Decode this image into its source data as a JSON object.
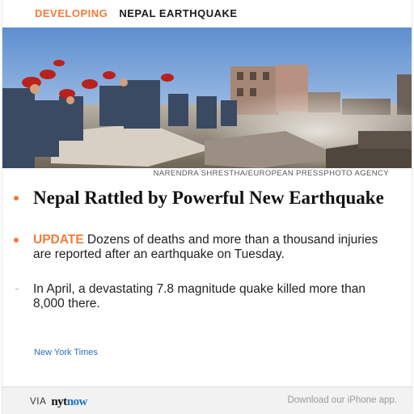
{
  "header": {
    "tag": "DEVELOPING",
    "topic": "NEPAL EARTHQUAKE"
  },
  "photo": {
    "credit": "NARENDRA SHRESTHA/EUROPEAN PRESSPHOTO AGENCY"
  },
  "article": {
    "headline": "Nepal Rattled by Powerful New Earthquake",
    "update_label": "UPDATE",
    "update_text": " Dozens of deaths and more than a thousand injuries are reported after an earthquake on Tuesday.",
    "bullet_text": "In April, a devastating 7.8 magnitude quake killed more than 8,000 there.",
    "source": "New York Times"
  },
  "footer": {
    "via": "VIA",
    "logo_nyt": "nyt",
    "logo_now": "now",
    "download": "Download our iPhone app."
  },
  "colors": {
    "accent": "#f47a3a",
    "link": "#2c6fb8",
    "brand_now": "#1e73c8"
  }
}
